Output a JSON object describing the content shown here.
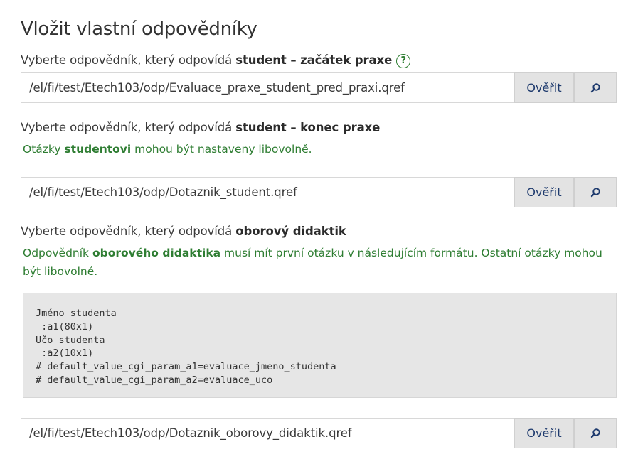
{
  "page": {
    "title": "Vložit vlastní odpovědníky"
  },
  "sections": [
    {
      "label_prefix": "Vyberte odpovědník, který odpovídá ",
      "label_bold": "student – začátek praxe",
      "help_icon": "question-circle-icon",
      "help_symbol": "?",
      "path_value": "/el/fi/test/Etech103/odp/Evaluace_praxe_student_pred_praxi.qref",
      "verify_label": "Ověřit",
      "search_icon": "magnifier-icon"
    },
    {
      "label_prefix": "Vyberte odpovědník, který odpovídá ",
      "label_bold": "student – konec praxe",
      "note_prefix": "Otázky ",
      "note_bold": "studentovi",
      "note_suffix": " mohou být nastaveny libovolně.",
      "path_value": "/el/fi/test/Etech103/odp/Dotaznik_student.qref",
      "verify_label": "Ověřit",
      "search_icon": "magnifier-icon"
    },
    {
      "label_prefix": "Vyberte odpovědník, který odpovídá ",
      "label_bold": "oborový didaktik",
      "note_prefix": "Odpovědník ",
      "note_bold": "oborového didaktika",
      "note_suffix": " musí mít první otázku v následujícím formátu. Ostatní otázky mohou být libovolné.",
      "code_sample": "Jméno studenta\n :a1(80x1)\nUčo studenta\n :a2(10x1)\n# default_value_cgi_param_a1=evaluace_jmeno_studenta\n# default_value_cgi_param_a2=evaluace_uco",
      "path_value": "/el/fi/test/Etech103/odp/Dotaznik_oborovy_didaktik.qref",
      "verify_label": "Ověřit",
      "search_icon": "magnifier-icon"
    }
  ],
  "colors": {
    "text": "#3a3a3a",
    "note_green": "#2e7d32",
    "button_bg": "#e3e3e3",
    "button_text": "#1f3b6e",
    "code_bg": "#e6e6e6"
  }
}
